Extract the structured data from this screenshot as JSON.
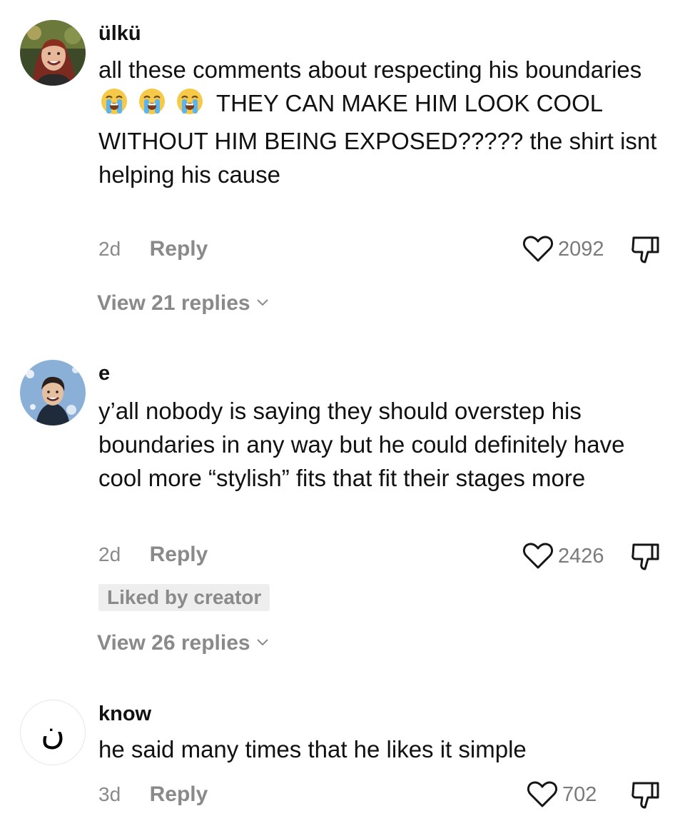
{
  "comments": [
    {
      "username": "ülkü",
      "text_before_emoji": "all these comments about respecting his boundaries",
      "emojis": [
        "loudly-crying-face",
        "loudly-crying-face",
        "loudly-crying-face"
      ],
      "text_after_emoji": "THEY CAN MAKE HIM LOOK COOL WITHOUT HIM BEING EXPOSED????? the shirt isnt helping his cause",
      "age": "2d",
      "reply_label": "Reply",
      "like_count": "2092",
      "view_replies": "View 21 replies"
    },
    {
      "username": "e",
      "text": "y’all nobody is saying they should overstep his boundaries in any way but he could definitely have cool more “stylish” fits that fit their stages more",
      "age": "2d",
      "reply_label": "Reply",
      "like_count": "2426",
      "badge": "Liked by creator",
      "view_replies": "View 26 replies"
    },
    {
      "username": "know",
      "avatar_glyph": "ن",
      "text": "he said many times that he likes it simple",
      "age": "3d",
      "reply_label": "Reply",
      "like_count": "702"
    }
  ],
  "icons": {
    "like": "heart-outline-icon",
    "dislike": "thumbs-down-outline-icon",
    "expand": "chevron-down-icon",
    "emoji": "loudly-crying-face"
  },
  "colors": {
    "text": "#111111",
    "muted": "#8a8a8a",
    "badge_bg": "#eeeeee"
  }
}
